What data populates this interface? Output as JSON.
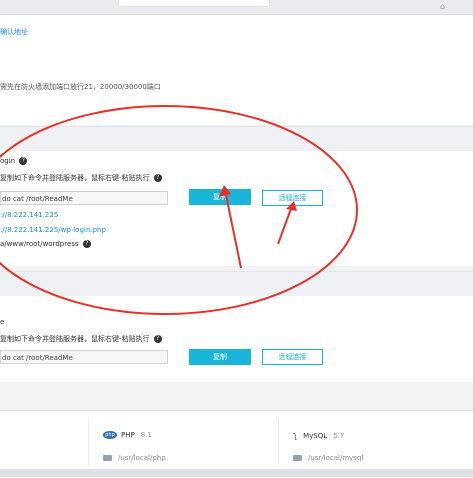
{
  "top_note": {
    "link": "确认地址",
    "text": "需先在防火墙添加端口放行21，20000/30000端口"
  },
  "login_section": {
    "label": "ogin",
    "instruction": "复制如下命令并登陆服务器，鼠标右键-粘贴执行",
    "command": "do cat /root/ReadMe",
    "copy_button": "复制",
    "remote_button": "远程连接",
    "url_1": "://8.222.141.225",
    "url_2": "://8.222.141.225/wp-login.php",
    "path": "a/www/root/wordpress"
  },
  "second_section": {
    "label": "e",
    "instruction": "复制如下命令并登陆服务器，鼠标右键-粘贴执行",
    "command": "do cat /root/ReadMe",
    "copy_button": "复制",
    "remote_button": "远程连接"
  },
  "software": [
    {
      "name": "PHP",
      "version": "8.1",
      "path": "/usr/local/php",
      "icon": "php-icon"
    },
    {
      "name": "MySQL",
      "version": "5.7",
      "path": "/usr/local/mysql",
      "icon": "mysql-icon"
    }
  ],
  "colors": {
    "accent": "#1ab4d8",
    "link": "#1d8fe0",
    "annotation": "#e8302a"
  }
}
